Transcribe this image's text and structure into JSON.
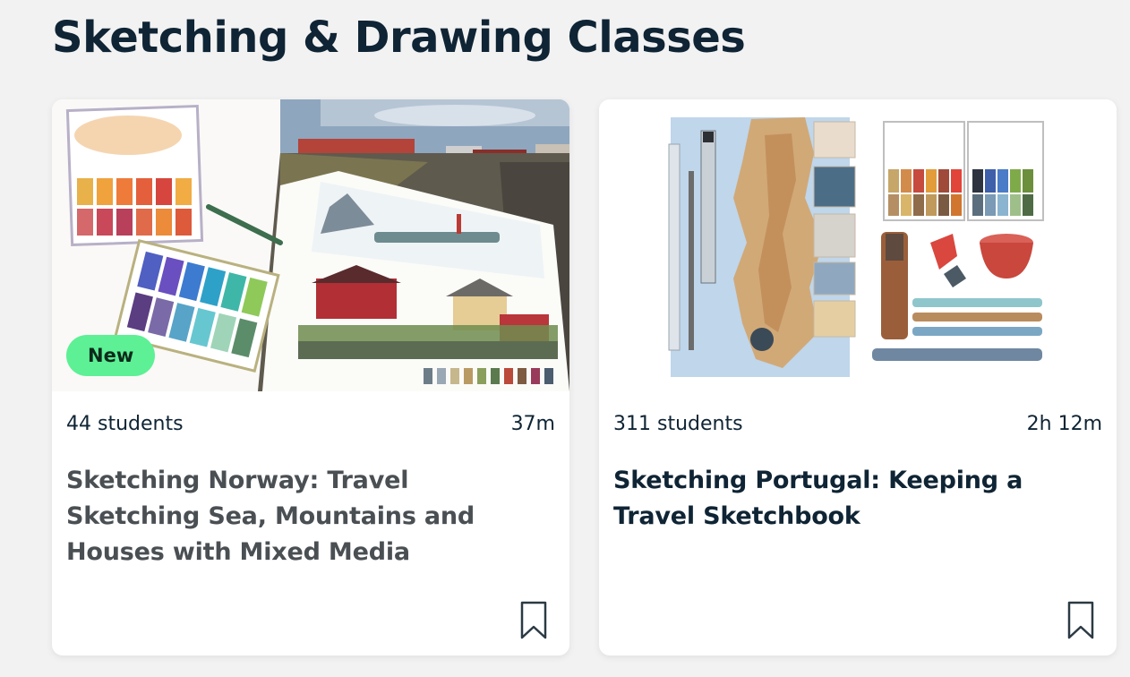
{
  "section": {
    "title": "Sketching & Drawing Classes"
  },
  "cards": [
    {
      "badge": "New",
      "students": "44 students",
      "duration": "37m",
      "title": "Sketching Norway: Travel Sketching Sea, Mountains and Houses with Mixed Media",
      "thumbnail_icon": "watercolor-sketchbook-norway-image",
      "bookmark_icon": "bookmark-icon"
    },
    {
      "students": "311 students",
      "duration": "2h 12m",
      "title": "Sketching Portugal: Keeping a Travel Sketchbook",
      "thumbnail_icon": "watercolor-map-portugal-image",
      "bookmark_icon": "bookmark-icon"
    }
  ],
  "colors": {
    "page_background": "#f2f2f2",
    "text_dark": "#0f2434",
    "text_muted_title": "#4a4f53",
    "badge_green": "#5df095",
    "card_background": "#ffffff"
  }
}
